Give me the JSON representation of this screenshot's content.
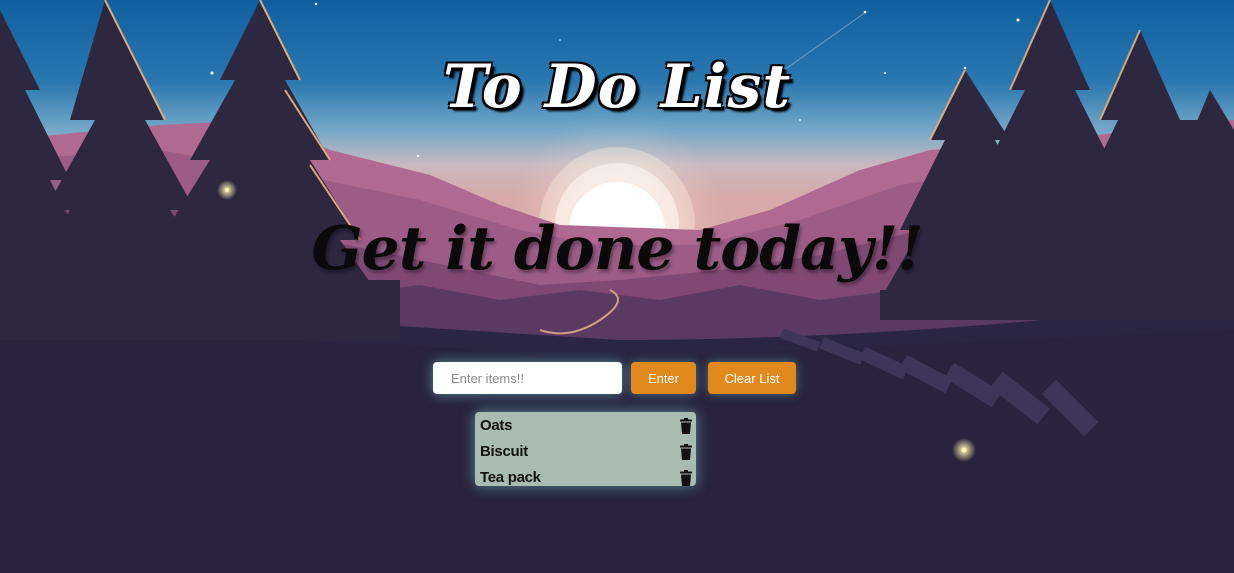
{
  "app": {
    "title": "To Do List",
    "subtitle": "Get it done today!!"
  },
  "input": {
    "placeholder": "Enter items!!",
    "value": ""
  },
  "buttons": {
    "enter_label": "Enter",
    "clear_label": "Clear List"
  },
  "list": {
    "items": [
      {
        "label": "Oats",
        "icon": "trash-icon"
      },
      {
        "label": "Biscuit",
        "icon": "trash-icon"
      },
      {
        "label": "Tea pack",
        "icon": "trash-icon"
      }
    ]
  },
  "colors": {
    "button_bg": "#e2891e",
    "list_bg": "#a9bcb2",
    "sky_top": "#0f5fa0",
    "mountains": "#9c5c86",
    "trees": "#2b2640"
  }
}
